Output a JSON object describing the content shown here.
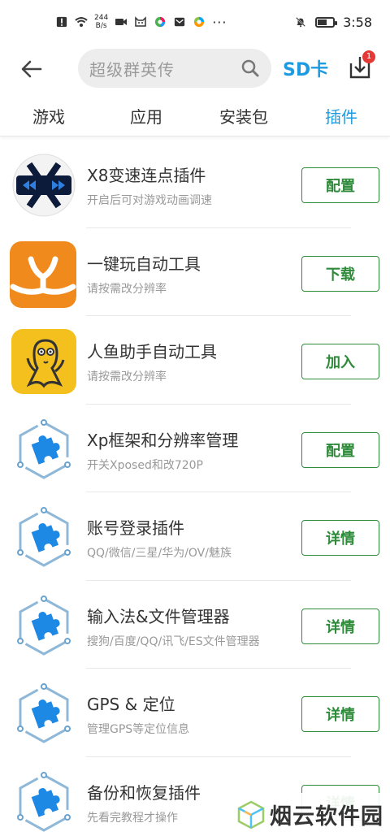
{
  "status_bar": {
    "net_speed_value": "244",
    "net_speed_unit": "B/s",
    "time": "3:58"
  },
  "header": {
    "search_placeholder": "超级群英传",
    "sd_card_label": "SD卡",
    "download_badge": "1"
  },
  "tabs": [
    {
      "label": "游戏",
      "active": false
    },
    {
      "label": "应用",
      "active": false
    },
    {
      "label": "安装包",
      "active": false
    },
    {
      "label": "插件",
      "active": true
    }
  ],
  "items": [
    {
      "name": "X8变速连点插件",
      "desc": "开启后可对游戏动画调速",
      "button": "配置",
      "icon": "x8-speed-icon"
    },
    {
      "name": "一键玩自动工具",
      "desc": "请按需改分辨率",
      "button": "下载",
      "icon": "y-logo-icon"
    },
    {
      "name": "人鱼助手自动工具",
      "desc": "请按需改分辨率",
      "button": "加入",
      "icon": "mermaid-icon"
    },
    {
      "name": "Xp框架和分辨率管理",
      "desc": "开关Xposed和改720P",
      "button": "配置",
      "icon": "puzzle-plugin-icon"
    },
    {
      "name": "账号登录插件",
      "desc": "QQ/微信/三星/华为/OV/魅族",
      "button": "详情",
      "icon": "puzzle-plugin-icon"
    },
    {
      "name": "输入法&文件管理器",
      "desc": "搜狗/百度/QQ/讯飞/ES文件管理器",
      "button": "详情",
      "icon": "puzzle-plugin-icon"
    },
    {
      "name": "GPS & 定位",
      "desc": "管理GPS等定位信息",
      "button": "详情",
      "icon": "puzzle-plugin-icon"
    },
    {
      "name": "备份和恢复插件",
      "desc": "先看完教程才操作",
      "button": "详情",
      "icon": "puzzle-plugin-icon"
    }
  ],
  "watermark": {
    "text": "烟云软件园"
  },
  "colors": {
    "accent_blue": "#1e9be0",
    "button_green": "#2e8b3a",
    "x8_bg": "#0d1b3a",
    "y_logo_bg": "#f08a1c",
    "mermaid_bg": "#f4c01e"
  }
}
